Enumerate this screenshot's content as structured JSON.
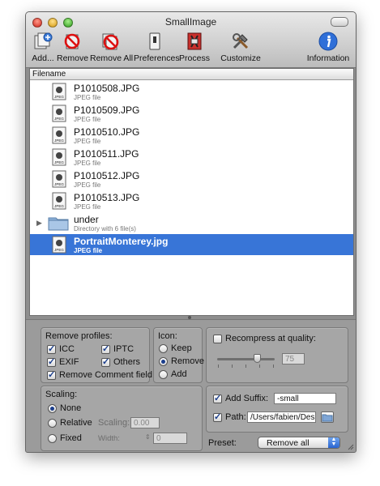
{
  "window": {
    "title": "SmallImage"
  },
  "toolbar": {
    "add_label": "Add...",
    "remove_label": "Remove",
    "remove_all_label": "Remove All",
    "preferences_label": "Preferences",
    "process_label": "Process",
    "customize_label": "Customize",
    "information_label": "Information"
  },
  "list": {
    "header": "Filename",
    "rows": [
      {
        "name": "P1010508.JPG",
        "kind": "JPEG file"
      },
      {
        "name": "P1010509.JPG",
        "kind": "JPEG file"
      },
      {
        "name": "P1010510.JPG",
        "kind": "JPEG file"
      },
      {
        "name": "P1010511.JPG",
        "kind": "JPEG file"
      },
      {
        "name": "P1010512.JPG",
        "kind": "JPEG file"
      },
      {
        "name": "P1010513.JPG",
        "kind": "JPEG file"
      },
      {
        "name": "under",
        "kind": "Directory with 6 file(s)"
      },
      {
        "name": "PortraitMonterey.jpg",
        "kind": "JPEG file"
      }
    ],
    "selected_index": 7
  },
  "remove_profiles": {
    "title": "Remove profiles:",
    "icc_label": "ICC",
    "icc_checked": true,
    "iptc_label": "IPTC",
    "iptc_checked": true,
    "exif_label": "EXIF",
    "exif_checked": true,
    "others_label": "Others",
    "others_checked": true,
    "comment_label": "Remove Comment field",
    "comment_checked": true
  },
  "icon_group": {
    "title": "Icon:",
    "keep_label": "Keep",
    "remove_label": "Remove",
    "add_label": "Add",
    "selected": "Remove"
  },
  "recompress": {
    "label": "Recompress at quality:",
    "checked": false,
    "quality_value": "75",
    "slider_fraction": 0.75
  },
  "scaling": {
    "title": "Scaling:",
    "none_label": "None",
    "relative_label": "Relative",
    "fixed_label": "Fixed",
    "selected": "None",
    "scaling_label": "Scaling:",
    "scaling_value": "0.00",
    "width_label": "Width:",
    "fixed_value": "0"
  },
  "suffix": {
    "label": "Add Suffix:",
    "checked": true,
    "value": "-small"
  },
  "path": {
    "label": "Path:",
    "checked": true,
    "value": "/Users/fabien/Des"
  },
  "preset": {
    "label": "Preset:",
    "value": "Remove all"
  },
  "colors": {
    "selection": "#3875d7",
    "info_blue": "#2f6fd8"
  }
}
